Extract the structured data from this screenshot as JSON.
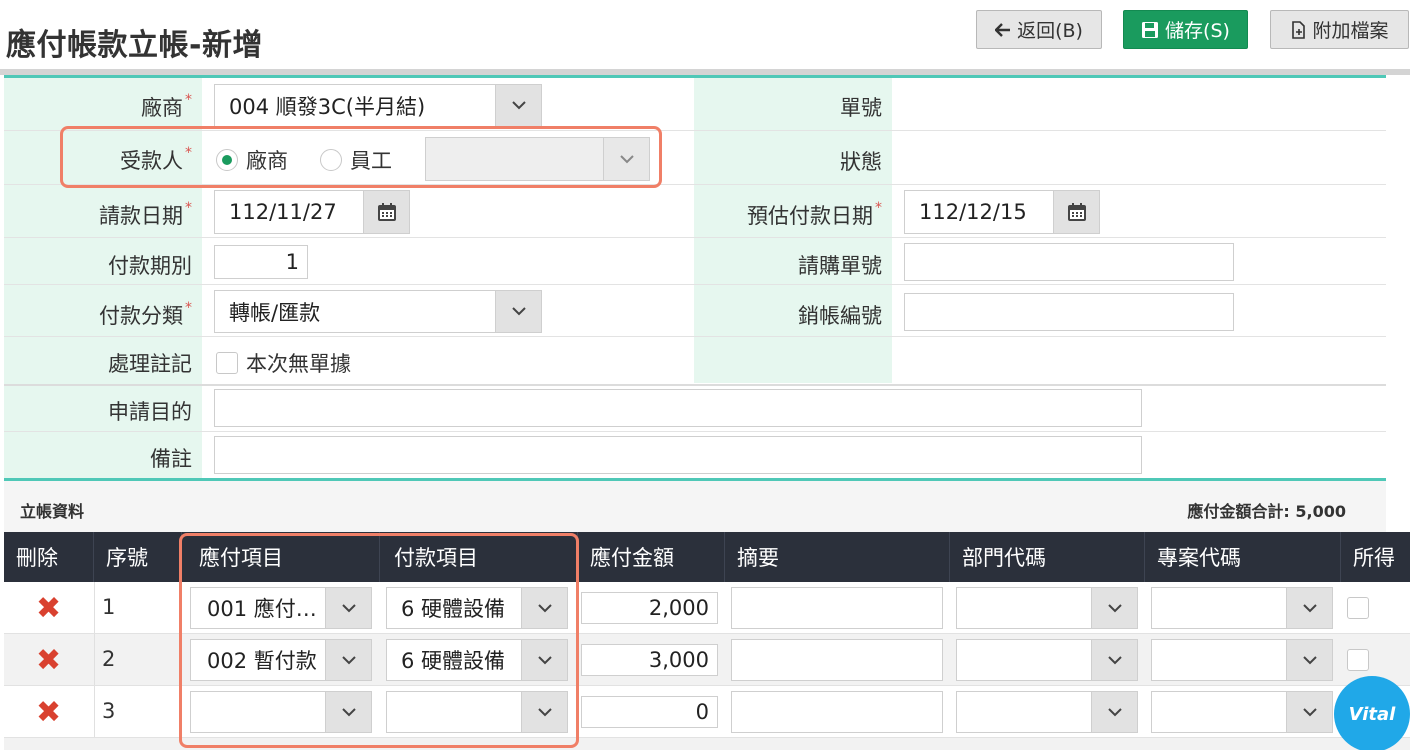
{
  "header": {
    "title": "應付帳款立帳-新增",
    "back_label": "返回(B)",
    "save_label": "儲存(S)",
    "attach_label": "附加檔案"
  },
  "form": {
    "vendor_label": "廠商",
    "vendor_value": "004 順發3C(半月結)",
    "payee_label": "受款人",
    "payee_option_vendor": "廠商",
    "payee_option_employee": "員工",
    "payee_selected": "廠商",
    "request_date_label": "請款日期",
    "request_date_value": "112/11/27",
    "period_label": "付款期別",
    "period_value": "1",
    "pay_type_label": "付款分類",
    "pay_type_value": "轉帳/匯款",
    "note_label": "處理註記",
    "no_receipt_label": "本次無單據",
    "purpose_label": "申請目的",
    "remark_label": "備註",
    "doc_no_label": "單號",
    "status_label": "狀態",
    "est_pay_date_label": "預估付款日期",
    "est_pay_date_value": "112/12/15",
    "purchase_no_label": "請購單號",
    "writeoff_no_label": "銷帳編號"
  },
  "detail": {
    "section_title": "立帳資料",
    "total_label": "應付金額合計: 5,000",
    "columns": [
      "刪除",
      "序號",
      "應付項目",
      "付款項目",
      "應付金額",
      "摘要",
      "部門代碼",
      "專案代碼",
      "所得"
    ],
    "rows": [
      {
        "seq": "1",
        "payable_item": "001 應付…",
        "payment_item": "6 硬體設備",
        "amount": "2,000"
      },
      {
        "seq": "2",
        "payable_item": "002 暫付款",
        "payment_item": "6 硬體設備",
        "amount": "3,000"
      },
      {
        "seq": "3",
        "payable_item": "",
        "payment_item": "",
        "amount": "0"
      }
    ]
  },
  "badge": {
    "text": "Vital"
  },
  "colors": {
    "accent": "#4fc8b7",
    "primary": "#1a9b5e",
    "highlight": "#f07f67",
    "label_bg": "#e6f7ef",
    "grid_header": "#2b303b",
    "delete": "#d9412f"
  },
  "icons": [
    "arrow-left-icon",
    "floppy-disk-icon",
    "attach-file-icon",
    "chevron-down-icon",
    "calendar-icon",
    "delete-x-icon"
  ]
}
